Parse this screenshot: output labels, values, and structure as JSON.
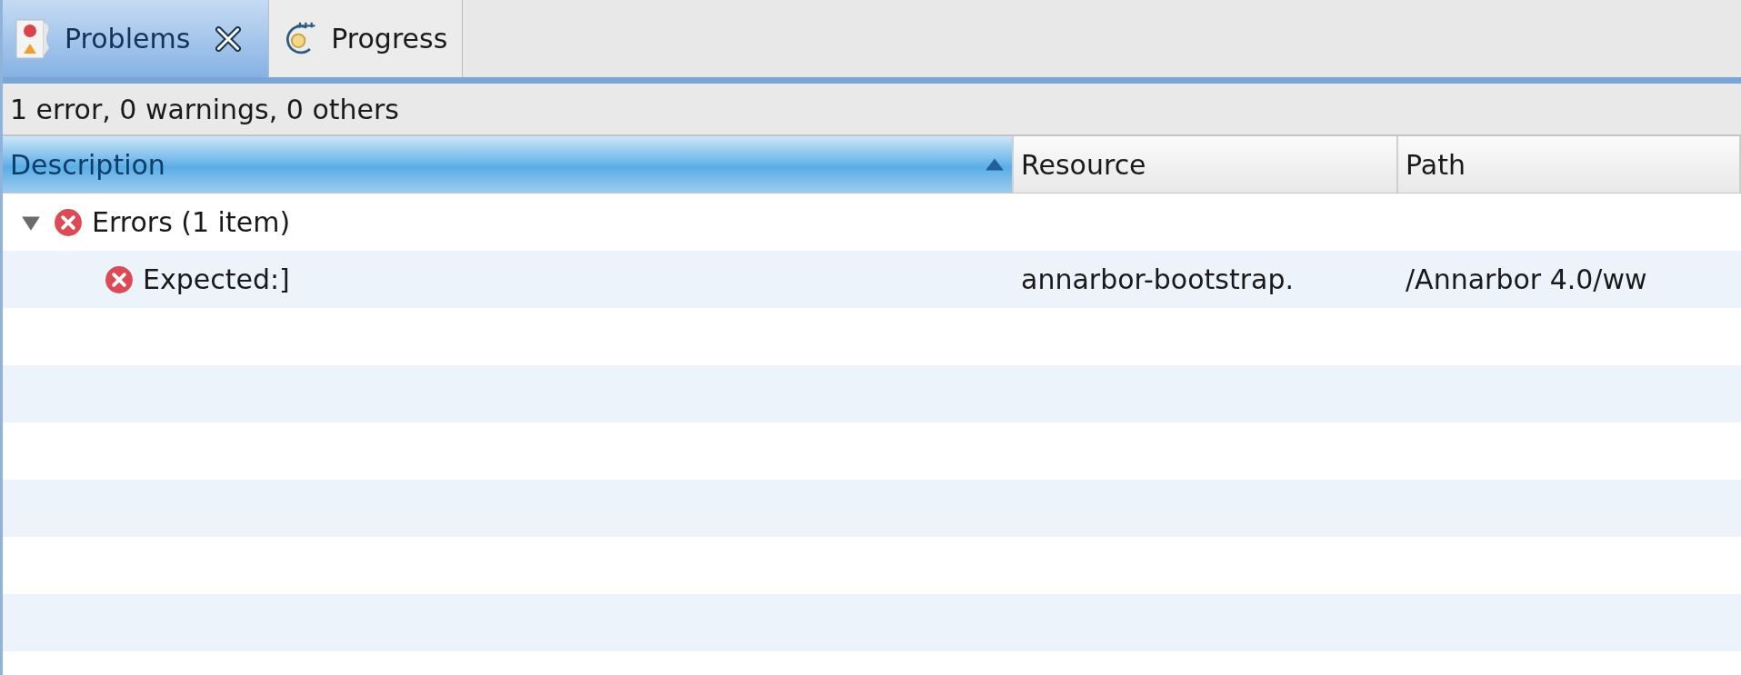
{
  "tabs": [
    {
      "label": "Problems",
      "kind": "problems",
      "selected": true
    },
    {
      "label": "Progress",
      "kind": "progress",
      "selected": false
    }
  ],
  "summary": "1 error, 0 warnings, 0 others",
  "columns": [
    {
      "label": "Description",
      "sorted": true
    },
    {
      "label": "Resource",
      "sorted": false
    },
    {
      "label": "Path",
      "sorted": false
    }
  ],
  "rows": [
    {
      "description": "Errors (1 item)",
      "kind": "error",
      "expanded": true,
      "children": [
        {
          "description": "Expected:]",
          "kind": "error",
          "resource": "annarbor-bootstrap.",
          "path": "/Annarbor 4.0/ww"
        }
      ]
    }
  ]
}
